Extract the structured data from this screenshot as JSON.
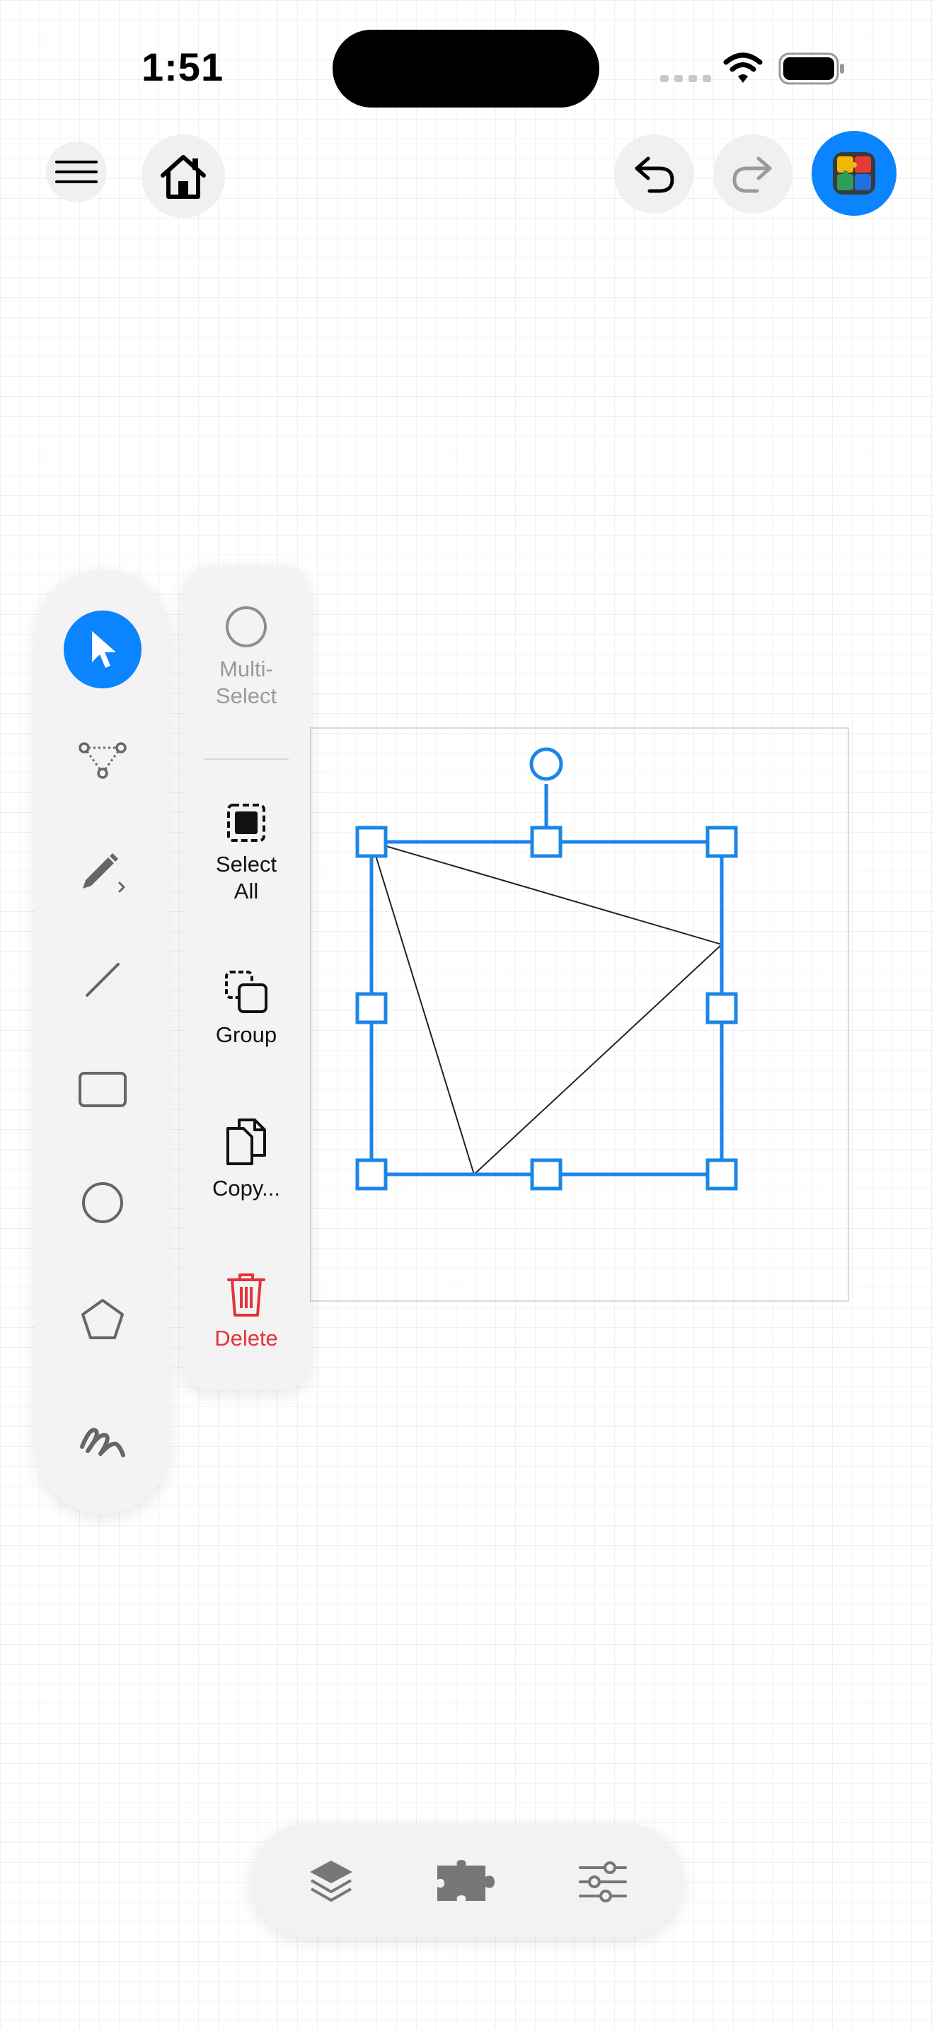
{
  "status_bar": {
    "time": "1:51"
  },
  "top_bar": {
    "menu_icon": "hamburger-icon",
    "home_icon": "home-icon",
    "undo_icon": "undo-icon",
    "redo_icon": "redo-icon",
    "app_icon": "puzzle-app-icon"
  },
  "tools": [
    {
      "name": "select",
      "icon": "pointer-icon",
      "active": true
    },
    {
      "name": "path",
      "icon": "node-path-icon"
    },
    {
      "name": "pencil",
      "icon": "pencil-icon"
    },
    {
      "name": "line",
      "icon": "line-icon"
    },
    {
      "name": "rectangle",
      "icon": "rectangle-icon"
    },
    {
      "name": "ellipse",
      "icon": "circle-icon"
    },
    {
      "name": "polygon",
      "icon": "pentagon-icon"
    },
    {
      "name": "freehand",
      "icon": "scribble-icon"
    }
  ],
  "actions": {
    "multi_select": "Multi-Select",
    "multi_select_line1": "Multi-",
    "multi_select_line2": "Select",
    "select_all_line1": "Select",
    "select_all_line2": "All",
    "group": "Group",
    "copy": "Copy...",
    "delete": "Delete"
  },
  "bottom_bar": {
    "layers_icon": "layers-icon",
    "plugins_icon": "puzzle-icon",
    "settings_icon": "sliders-icon"
  },
  "colors": {
    "accent": "#0a84ff",
    "delete": "#e5323c",
    "selection": "#1a86e8"
  }
}
